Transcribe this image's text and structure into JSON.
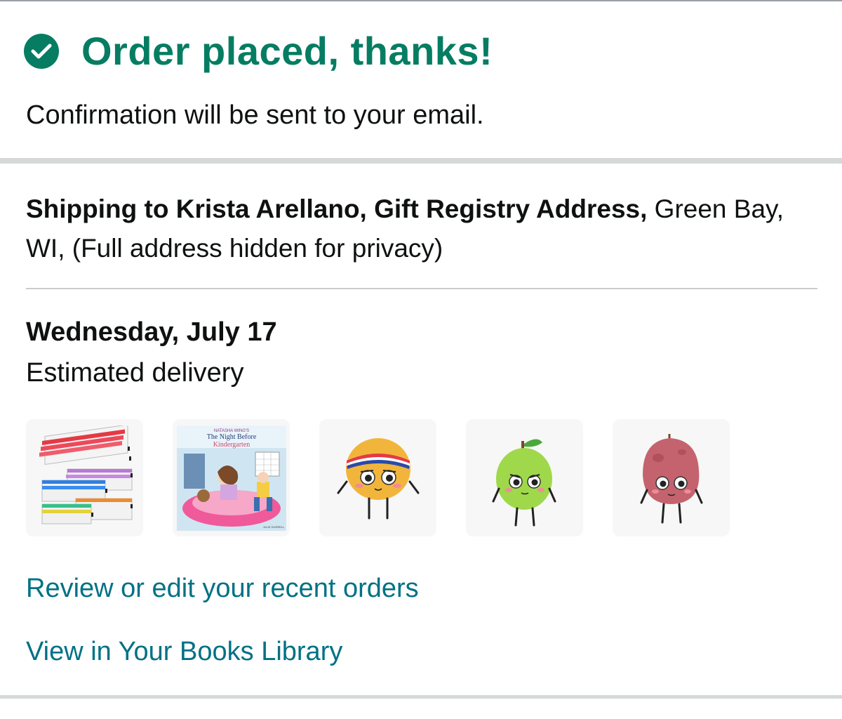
{
  "header": {
    "title": "Order placed, thanks!",
    "subtitle": "Confirmation will be sent to your email.",
    "icon": "check-circle-icon",
    "accent_color": "#067d62"
  },
  "shipping": {
    "bold_text": "Shipping to Krista Arellano, Gift Registry Address,",
    "rest_text": " Green Bay, WI, (Full address hidden for privacy)"
  },
  "delivery": {
    "date": "Wednesday, July 17",
    "label": "Estimated delivery"
  },
  "items": [
    {
      "name": "mesh-zipper-pouches-image"
    },
    {
      "name": "book-the-night-before-kindergarten-image",
      "book_author": "NATASHA WING'S",
      "book_title_line1": "The Night Before",
      "book_title_line2": "Kindergarten",
      "book_illustrator": "JULIE DURRELL"
    },
    {
      "name": "orange-plush-toy-image"
    },
    {
      "name": "green-apple-plush-toy-image"
    },
    {
      "name": "potato-plush-toy-image"
    }
  ],
  "links": {
    "review_orders": "Review or edit your recent orders",
    "books_library": "View in Your Books Library",
    "link_color": "#007185"
  }
}
